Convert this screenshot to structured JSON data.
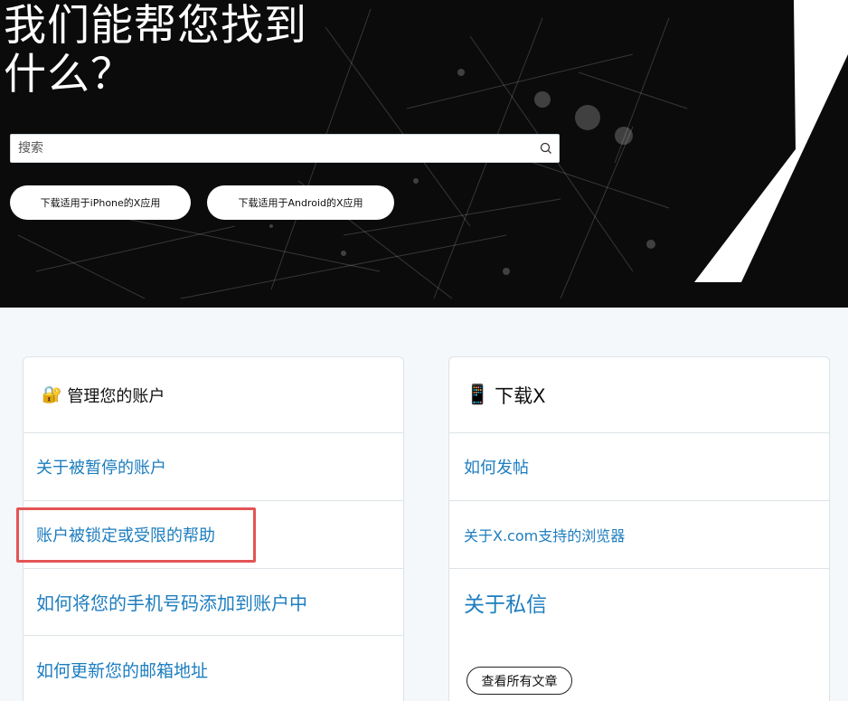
{
  "hero": {
    "title_line1": "我们能帮您找到",
    "title_line2": "什么？",
    "search": {
      "placeholder": "搜索",
      "value": ""
    },
    "buttons": {
      "ios": "下载适用于iPhone的X应用",
      "android": "下载适用于Android的X应用"
    }
  },
  "cards": {
    "account": {
      "emoji": "🔐",
      "title": "管理您的账户",
      "links": [
        "关于被暂停的账户",
        "账户被锁定或受限的帮助",
        "如何将您的手机号码添加到账户中",
        "如何更新您的邮箱地址"
      ]
    },
    "download": {
      "emoji": "📱",
      "title": "下载X",
      "links": [
        "如何发帖",
        "关于X.com支持的浏览器",
        "关于私信"
      ],
      "view_all": "查看所有文章"
    }
  },
  "colors": {
    "link": "#1d7dbf",
    "highlight": "#e35454",
    "hero_bg": "#0b0b0b"
  }
}
